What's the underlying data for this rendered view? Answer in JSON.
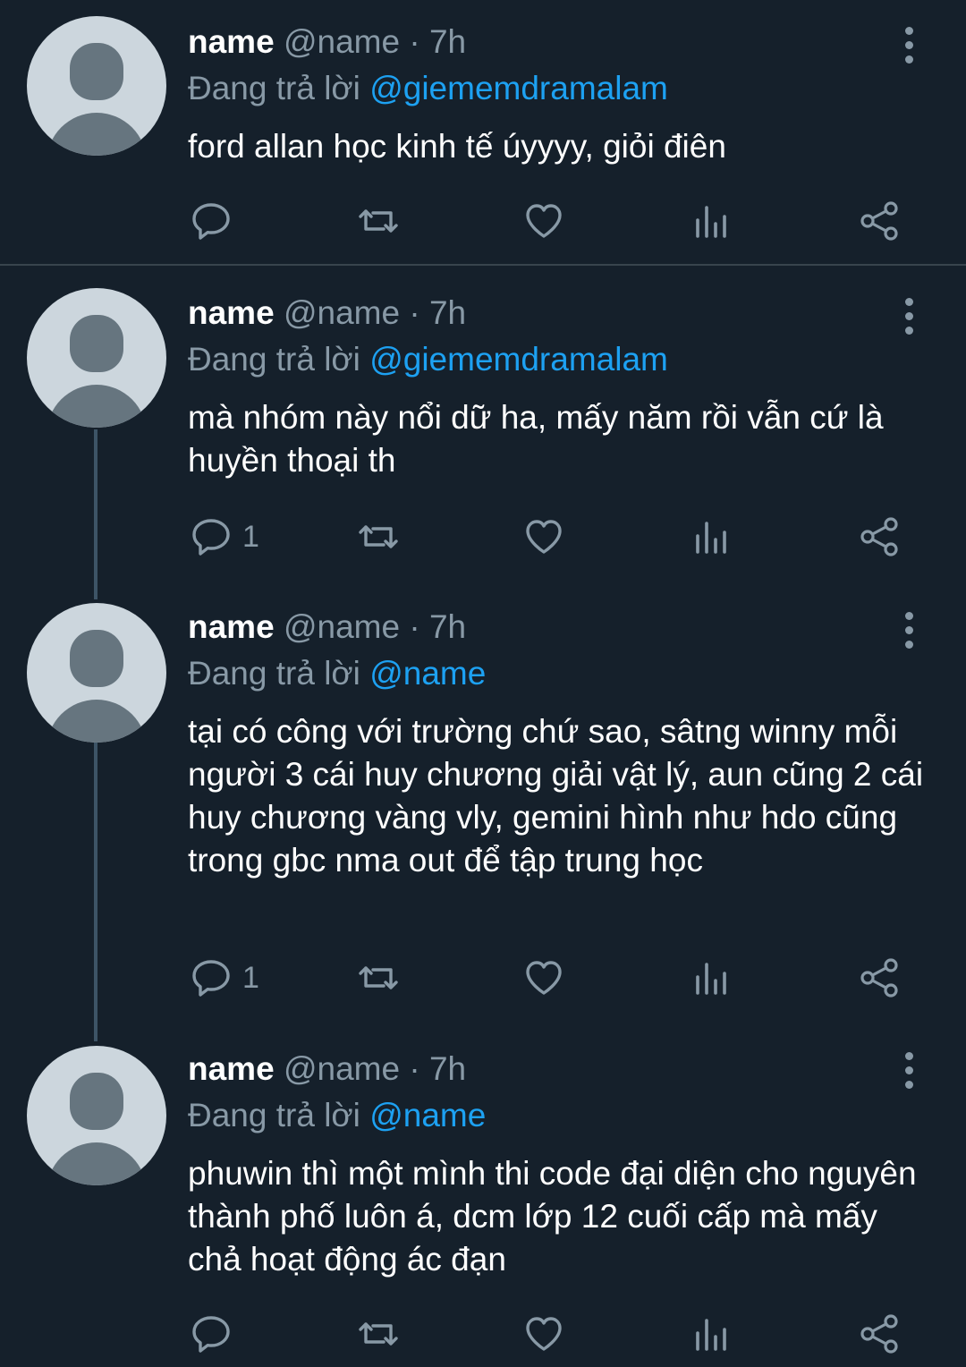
{
  "tweets": [
    {
      "name": "name",
      "handle": "@name",
      "time": "7h",
      "reply_prefix": "Đang trả lời",
      "reply_to": "@giememdramalam",
      "text": "ford allan học kinh tế úyyyy, giỏi điên",
      "reply_count": ""
    },
    {
      "name": "name",
      "handle": "@name",
      "time": "7h",
      "reply_prefix": "Đang trả lời",
      "reply_to": "@giememdramalam",
      "text": "mà nhóm này nổi dữ ha, mấy năm rồi vẫn cứ là huyền thoại th",
      "reply_count": "1"
    },
    {
      "name": "name",
      "handle": "@name",
      "time": "7h",
      "reply_prefix": "Đang trả lời",
      "reply_to": "@name",
      "text": "tại có công với trường chứ sao, sâtng winny mỗi người 3 cái huy chương giải vật lý, aun cũng 2 cái huy chương vàng vly, gemini hình như hdo cũng trong gbc nma out để tập trung học",
      "reply_count": "1"
    },
    {
      "name": "name",
      "handle": "@name",
      "time": "7h",
      "reply_prefix": "Đang trả lời",
      "reply_to": "@name",
      "text": "phuwin thì một mình thi code đại diện cho nguyên thành phố luôn á, dcm lớp 12 cuối cấp mà mấy chả hoạt động ác đạn",
      "reply_count": ""
    }
  ],
  "colors": {
    "background": "#15202b",
    "secondary_text": "#8899a6",
    "link": "#1da1f2",
    "divider": "#38444d",
    "avatar_bg": "#ccd6dd",
    "avatar_fg": "#66757f"
  },
  "icons": [
    "reply-icon",
    "retweet-icon",
    "like-icon",
    "analytics-icon",
    "share-icon",
    "more-icon"
  ]
}
